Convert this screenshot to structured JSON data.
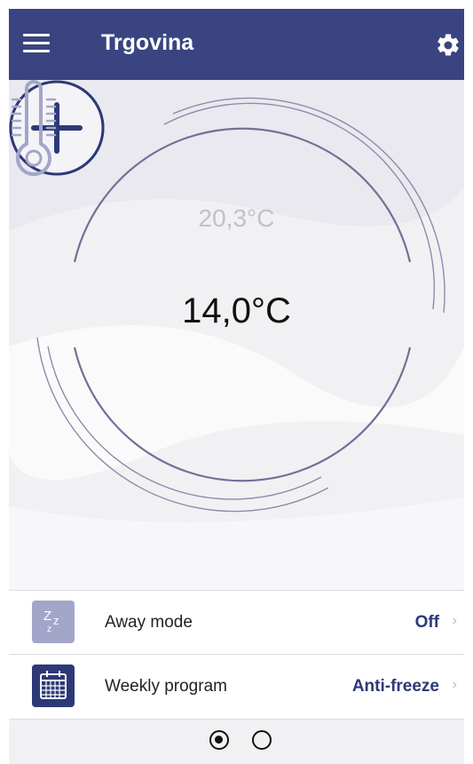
{
  "header": {
    "title": "Trgovina",
    "menu_icon": "hamburger-menu-icon",
    "settings_icon": "gear-icon"
  },
  "thermostat": {
    "current_temperature": "20,3°C",
    "target_temperature": "14,0°C",
    "decrease_icon": "minus-icon",
    "increase_icon": "plus-icon",
    "thermometer_icon": "thermometer-icon"
  },
  "rows": [
    {
      "label": "Away mode",
      "value": "Off",
      "icon": "sleep-zzz-icon",
      "chevron": "›"
    },
    {
      "label": "Weekly program",
      "value": "Anti-freeze",
      "icon": "calendar-icon",
      "chevron": "›"
    }
  ],
  "pager": {
    "pages": 2,
    "active_page": 1
  },
  "colors": {
    "header_bg": "#3a4480",
    "accent": "#2d3977",
    "away_icon_bg": "#a3a6c9",
    "current_temp_text": "#c1c1c8"
  }
}
